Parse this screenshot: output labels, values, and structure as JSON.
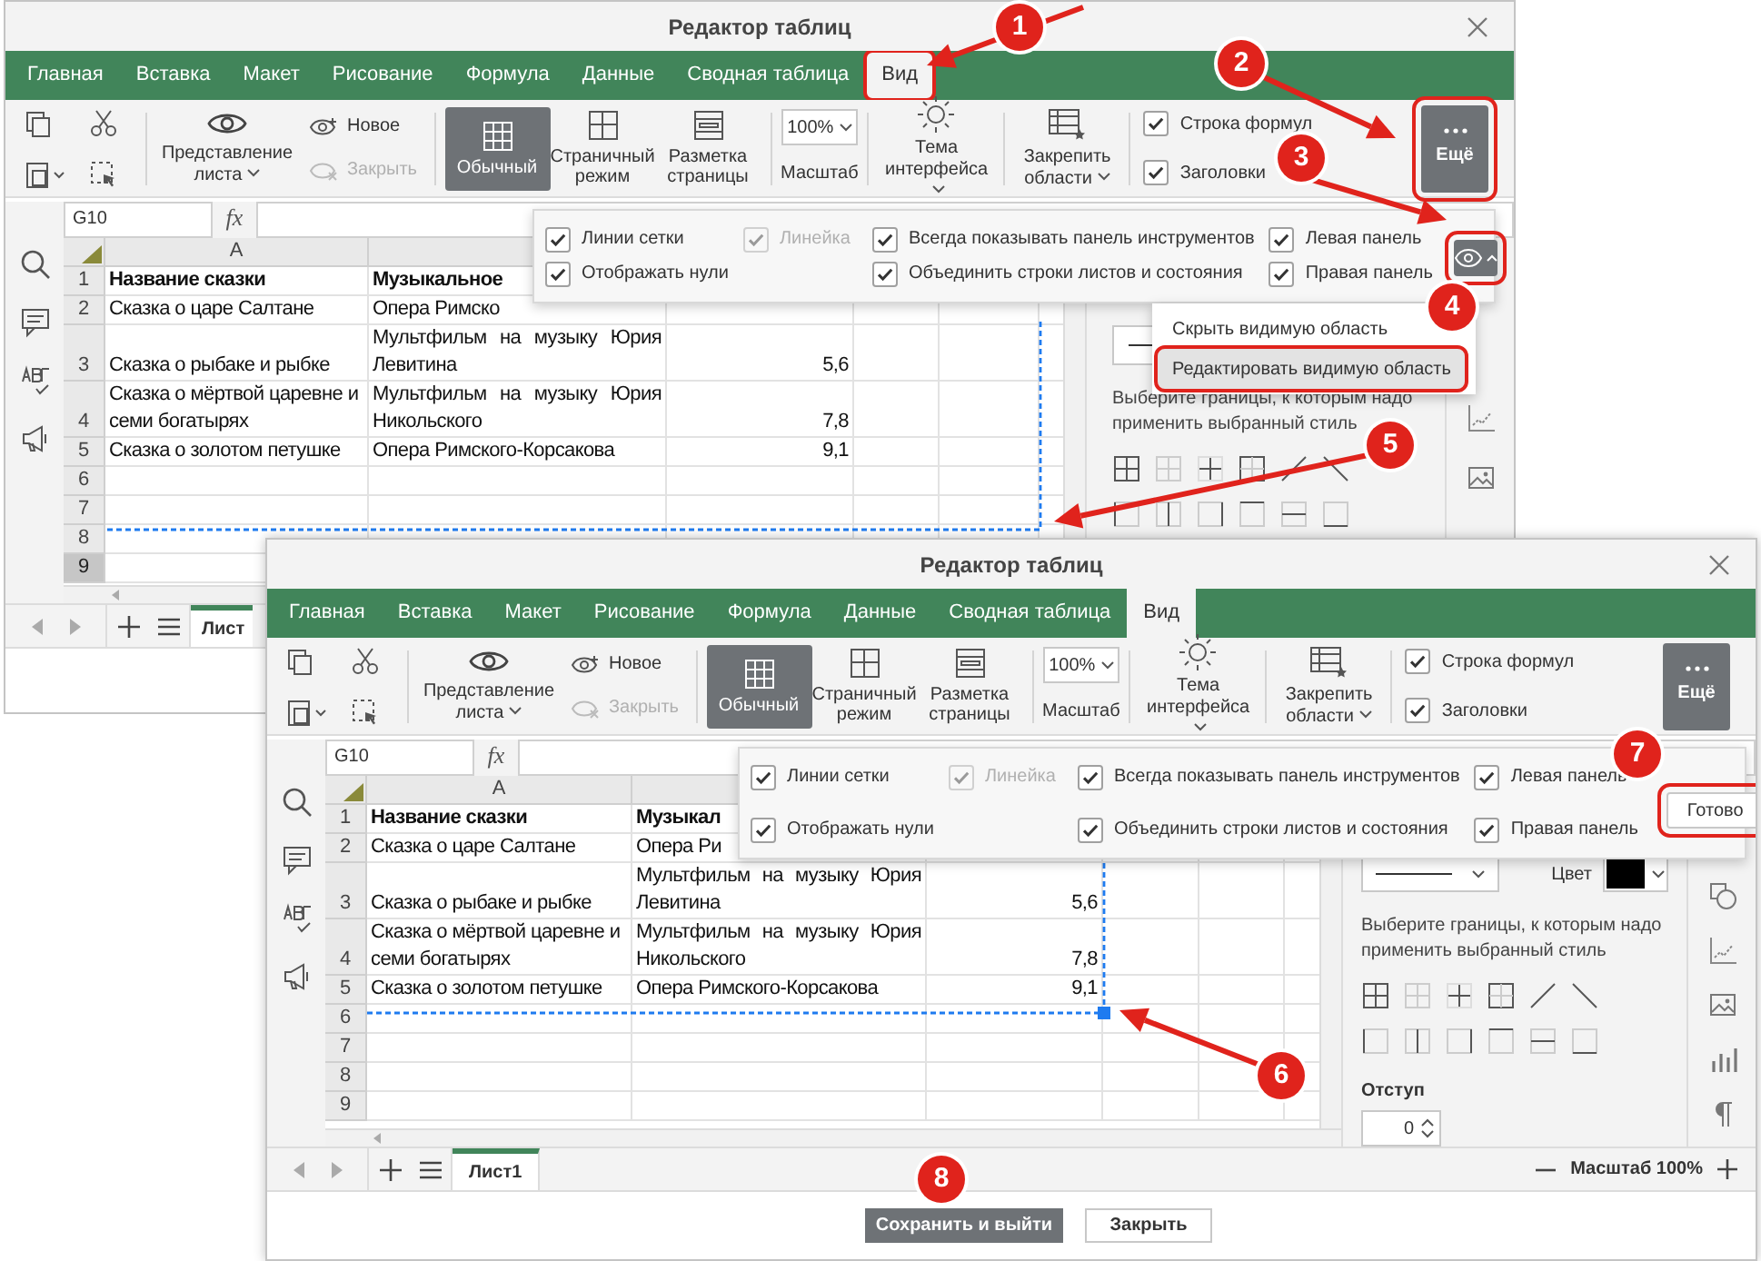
{
  "windows": [
    {
      "title": "Редактор таблиц",
      "tabs": [
        {
          "label": "Главная",
          "selected": false
        },
        {
          "label": "Вставка",
          "selected": false
        },
        {
          "label": "Макет",
          "selected": false
        },
        {
          "label": "Рисование",
          "selected": false
        },
        {
          "label": "Формула",
          "selected": false
        },
        {
          "label": "Данные",
          "selected": false
        },
        {
          "label": "Сводная таблица",
          "selected": false
        },
        {
          "label": "Вид",
          "selected": true
        }
      ],
      "ribbon": {
        "sheet_view": "Представление листа",
        "new_view": "Новое",
        "close_view": {
          "label": "Закрыть",
          "disabled": true
        },
        "view_modes": [
          {
            "label": "Обычный",
            "selected": true
          },
          {
            "label": "Страничный режим",
            "selected": false
          },
          {
            "label": "Разметка страницы",
            "selected": false
          }
        ],
        "zoom": {
          "value": "100%",
          "label": "Масштаб"
        },
        "theme": "Тема интерфейса",
        "freeze": "Закрепить области",
        "checks": [
          {
            "label": "Строка формул",
            "checked": true
          },
          {
            "label": "Заголовки",
            "checked": true
          }
        ],
        "more": {
          "label": "Ещё",
          "pressed": true
        }
      },
      "name_box": "G10",
      "fx": "fx",
      "columns": [
        "A"
      ],
      "rows": [
        {
          "number": "1",
          "bold": true,
          "selected": false,
          "cells": [
            "Название сказки",
            "Музыкальное"
          ]
        },
        {
          "number": "2",
          "bold": false,
          "selected": false,
          "cells": [
            "Сказка о царе Салтане",
            "Опера Римско"
          ]
        },
        {
          "number": "3",
          "bold": false,
          "selected": false,
          "cells": [
            "Сказка о рыбаке и рыбке",
            "Мультфильм на музыку Юрия Левитина",
            "5,6"
          ]
        },
        {
          "number": "4",
          "bold": false,
          "selected": false,
          "cells": [
            "Сказка о мёртвой царевне и семи богатырях",
            "Мультфильм на музыку Юрия Никольского",
            "7,8"
          ]
        },
        {
          "number": "5",
          "bold": false,
          "selected": false,
          "cells": [
            "Сказка о золотом петушке",
            "Опера Римского-Корсакова",
            "9,1"
          ]
        },
        {
          "number": "6",
          "bold": false,
          "selected": false,
          "cells": []
        },
        {
          "number": "7",
          "bold": false,
          "selected": false,
          "cells": []
        },
        {
          "number": "8",
          "bold": false,
          "selected": false,
          "cells": []
        },
        {
          "number": "9",
          "bold": false,
          "selected": true,
          "cells": []
        }
      ],
      "view_options": {
        "columns": [
          [
            {
              "label": "Линии сетки",
              "checked": true,
              "disabled": false
            },
            {
              "label": "Отображать нули",
              "checked": true,
              "disabled": false
            }
          ],
          [
            {
              "label": "Линейка",
              "checked": true,
              "disabled": true
            }
          ],
          [
            {
              "label": "Всегда показывать панель инструментов",
              "checked": true,
              "disabled": false
            },
            {
              "label": "Объединить строки листов и состояния",
              "checked": true,
              "disabled": false
            }
          ],
          [
            {
              "label": "Левая панель",
              "checked": true,
              "disabled": false
            },
            {
              "label": "Правая панель",
              "checked": true,
              "disabled": false
            }
          ]
        ],
        "visible_area_button": {
          "pressed": true
        }
      },
      "visible_area_menu": {
        "items": [
          {
            "label": "Скрыть видимую область",
            "selected": false
          },
          {
            "label": "Редактировать видимую область",
            "selected": true
          }
        ]
      },
      "format_panel": {
        "border_hint": "Выберите границы, к которым надо применить выбранный стиль"
      },
      "sheet_tabs": [
        {
          "label": "Лист",
          "selected": true
        }
      ]
    },
    {
      "title": "Редактор таблиц",
      "tabs": [
        {
          "label": "Главная",
          "selected": false
        },
        {
          "label": "Вставка",
          "selected": false
        },
        {
          "label": "Макет",
          "selected": false
        },
        {
          "label": "Рисование",
          "selected": false
        },
        {
          "label": "Формула",
          "selected": false
        },
        {
          "label": "Данные",
          "selected": false
        },
        {
          "label": "Сводная таблица",
          "selected": false
        },
        {
          "label": "Вид",
          "selected": true
        }
      ],
      "ribbon": {
        "sheet_view": "Представление листа",
        "new_view": "Новое",
        "close_view": {
          "label": "Закрыть",
          "disabled": true
        },
        "view_modes": [
          {
            "label": "Обычный",
            "selected": true
          },
          {
            "label": "Страничный режим",
            "selected": false
          },
          {
            "label": "Разметка страницы",
            "selected": false
          }
        ],
        "zoom": {
          "value": "100%",
          "label": "Масштаб"
        },
        "theme": "Тема интерфейса",
        "freeze": "Закрепить области",
        "checks": [
          {
            "label": "Строка формул",
            "checked": true
          },
          {
            "label": "Заголовки",
            "checked": true
          }
        ],
        "more": {
          "label": "Ещё",
          "pressed": true
        }
      },
      "name_box": "G10",
      "fx": "fx",
      "columns": [
        "A"
      ],
      "rows": [
        {
          "number": "1",
          "bold": true,
          "selected": false,
          "cells": [
            "Название сказки",
            "Музыкал"
          ]
        },
        {
          "number": "2",
          "bold": false,
          "selected": false,
          "cells": [
            "Сказка о царе Салтане",
            "Опера Ри"
          ]
        },
        {
          "number": "3",
          "bold": false,
          "selected": false,
          "cells": [
            "Сказка о рыбаке и рыбке",
            "Мультфильм на музыку Юрия Левитина",
            "5,6"
          ]
        },
        {
          "number": "4",
          "bold": false,
          "selected": false,
          "cells": [
            "Сказка о мёртвой царевне и семи богатырях",
            "Мультфильм на музыку Юрия Никольского",
            "7,8"
          ]
        },
        {
          "number": "5",
          "bold": false,
          "selected": false,
          "cells": [
            "Сказка о золотом петушке",
            "Опера Римского-Корсакова",
            "9,1"
          ]
        },
        {
          "number": "6",
          "bold": false,
          "selected": false,
          "cells": []
        },
        {
          "number": "7",
          "bold": false,
          "selected": false,
          "cells": []
        },
        {
          "number": "8",
          "bold": false,
          "selected": false,
          "cells": []
        },
        {
          "number": "9",
          "bold": false,
          "selected": false,
          "cells": []
        }
      ],
      "view_options": {
        "columns": [
          [
            {
              "label": "Линии сетки",
              "checked": true,
              "disabled": false
            },
            {
              "label": "Отображать нули",
              "checked": true,
              "disabled": false
            }
          ],
          [
            {
              "label": "Линейка",
              "checked": true,
              "disabled": true
            }
          ],
          [
            {
              "label": "Всегда показывать панель инструментов",
              "checked": true,
              "disabled": false
            },
            {
              "label": "Объединить строки листов и состояния",
              "checked": true,
              "disabled": false
            }
          ],
          [
            {
              "label": "Левая панель",
              "checked": true,
              "disabled": false
            },
            {
              "label": "Правая панель",
              "checked": true,
              "disabled": false
            }
          ]
        ],
        "done_button": "Готово"
      },
      "format_panel": {
        "color_label": "Цвет",
        "border_hint": "Выберите границы, к которым надо применить выбранный стиль",
        "indent_label": "Отступ",
        "indent_value": "0"
      },
      "sheet_tabs": [
        {
          "label": "Лист1",
          "selected": true
        }
      ],
      "zoom_status": "Масштаб 100%",
      "footer_buttons": [
        {
          "label": "Сохранить и выйти",
          "kind": "primary"
        },
        {
          "label": "Закрыть",
          "kind": "secondary"
        }
      ]
    }
  ],
  "markers": [
    {
      "number": "1"
    },
    {
      "number": "2"
    },
    {
      "number": "3"
    },
    {
      "number": "4"
    },
    {
      "number": "5"
    },
    {
      "number": "6"
    },
    {
      "number": "7"
    },
    {
      "number": "8"
    }
  ]
}
